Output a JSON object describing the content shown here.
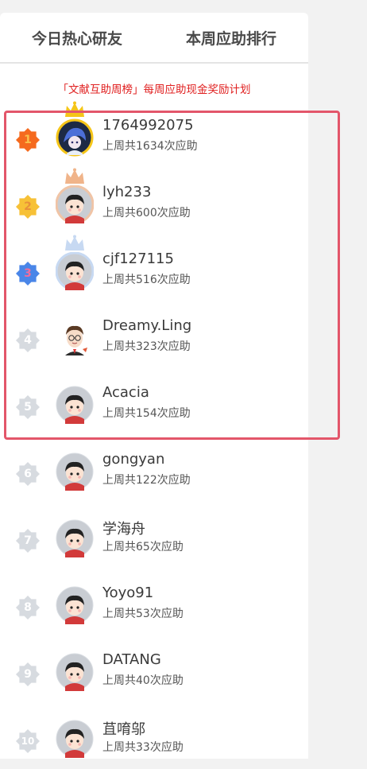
{
  "tabs": [
    {
      "label": "今日热心研友"
    },
    {
      "label": "本周应助排行"
    }
  ],
  "notice": "「文献互助周榜」每周应助现金奖励计划",
  "colors": {
    "gold": "#f56a1e",
    "silver": "#f7c137",
    "bronze": "#4a86e8",
    "highlight": "#e3566a",
    "notice": "#e02020"
  },
  "ranks": [
    {
      "rank": "1",
      "name": "1764992075",
      "count": "上周共1634次应助",
      "avatar": "anime-avatar-icon",
      "crown": "gold-crown-icon"
    },
    {
      "rank": "2",
      "name": "lyh233",
      "count": "上周共600次应助",
      "avatar": "default-avatar-icon",
      "crown": "bronze-crown-icon"
    },
    {
      "rank": "3",
      "name": "cjf127115",
      "count": "上周共516次应助",
      "avatar": "default-avatar-icon",
      "crown": "silver-crown-icon"
    },
    {
      "rank": "4",
      "name": "Dreamy.Ling",
      "count": "上周共323次应助",
      "avatar": "cartoon-avatar-icon",
      "crown": ""
    },
    {
      "rank": "5",
      "name": "Acacia",
      "count": "上周共154次应助",
      "avatar": "default-avatar-icon",
      "crown": ""
    },
    {
      "rank": "6",
      "name": "gongyan",
      "count": "上周共122次应助",
      "avatar": "default-avatar-icon",
      "crown": ""
    },
    {
      "rank": "7",
      "name": "学海舟",
      "count": "上周共65次应助",
      "avatar": "default-avatar-icon",
      "crown": ""
    },
    {
      "rank": "8",
      "name": "Yoyo91",
      "count": "上周共53次应助",
      "avatar": "default-avatar-icon",
      "crown": ""
    },
    {
      "rank": "9",
      "name": "DATANG",
      "count": "上周共40次应助",
      "avatar": "default-avatar-icon",
      "crown": ""
    },
    {
      "rank": "10",
      "name": "苴唷邬",
      "count": "上周共33次应助",
      "avatar": "default-avatar-icon",
      "crown": ""
    }
  ]
}
